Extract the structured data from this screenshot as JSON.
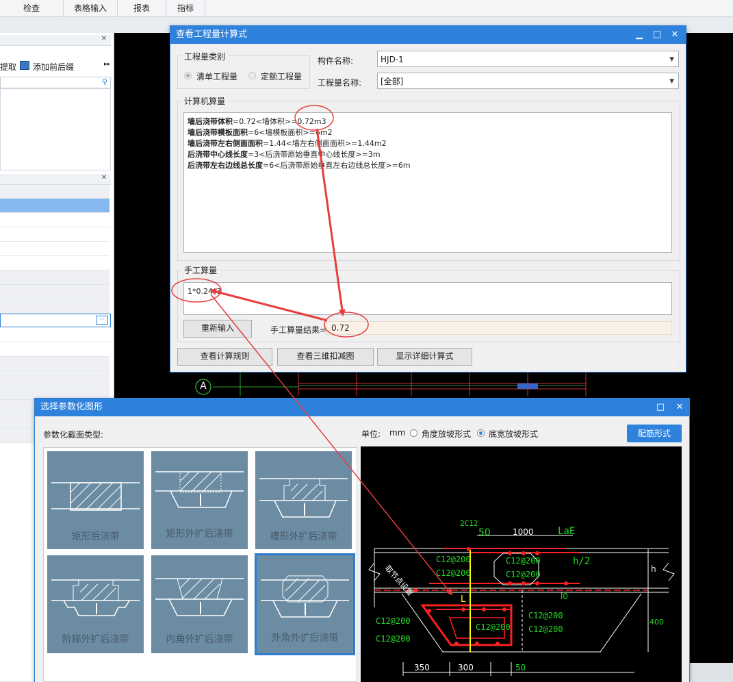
{
  "menu": [
    "检查",
    "表格输入",
    "报表",
    "指标"
  ],
  "left_panel": {
    "tool_extract": "提取",
    "tool_add_prefix": "添加前后缀"
  },
  "calc_dialog": {
    "title": "查看工程量计算式",
    "qty_type_group": "工程量类别",
    "radio_list": "清单工程量",
    "radio_quota": "定额工程量",
    "member_name_label": "构件名称:",
    "member_name_value": "HJD-1",
    "qty_name_label": "工程量名称:",
    "qty_name_value": "[全部]",
    "computer_group": "计算机算量",
    "lines": [
      {
        "name": "墙后浇带体积",
        "rest": "=0.72<墙体积>=0.72m3"
      },
      {
        "name": "墙后浇带模板面积",
        "rest": "=6<墙模板面积>=6m2"
      },
      {
        "name": "墙后浇带左右侧面面积",
        "rest": "=1.44<墙左右侧面面积>=1.44m2"
      },
      {
        "name": "后浇带中心线长度",
        "rest": "=3<后浇带原始垂直中心线长度>=3m"
      },
      {
        "name": "后浇带左右边线总长度",
        "rest": "=6<后浇带原始垂直左右边线总长度>=6m"
      }
    ],
    "manual_group": "手工算量",
    "manual_expr": "1*0.24*3",
    "reinput_btn": "重新输入",
    "manual_result_label": "手工算量结果=",
    "manual_result_value": "0.72",
    "btn_rules": "查看计算规则",
    "btn_3d": "查看三维扣减图",
    "btn_detail": "显示详细计算式"
  },
  "param_dialog": {
    "title": "选择参数化图形",
    "section_type_label": "参数化截面类型:",
    "unit_label": "单位:",
    "unit_value": "mm",
    "radio_angle": "角度放坡形式",
    "radio_width": "底宽放坡形式",
    "rebar_btn": "配筋形式",
    "shapes": [
      "矩形后浇带",
      "矩形外扩后浇带",
      "槽形外扩后浇带",
      "阶梯外扩后浇带",
      "内角外扩后浇带",
      "外角外扩后浇带"
    ],
    "selected_index": 5
  },
  "drawing_labels": {
    "d2c12": "2C12",
    "d50a": "50",
    "d1000": "1000",
    "dlae": "LaE",
    "dc12a": "C12@200",
    "dc12b": "C12@200",
    "dc12c": "C12@200",
    "dc12d": "C12@200",
    "dh2": "h/2",
    "dh": "h",
    "dL": "L",
    "dl0": "l0",
    "d400": "400",
    "dc12e": "C12@200",
    "dc12f": "C12@200",
    "dc12g": "C12@200",
    "dc12h": "C12@200",
    "dc12i": "C12@200",
    "d350": "350",
    "d300": "300",
    "d50b": "50",
    "dnote": "取节点设置"
  },
  "canvas": {
    "axis_label": "A"
  },
  "colors": {
    "accent": "#2f82dc",
    "annotation": "#e83c3c",
    "canvas": "#000000",
    "shape_fill": "#6b8ca3",
    "result_bg": "#fbf1e6"
  }
}
